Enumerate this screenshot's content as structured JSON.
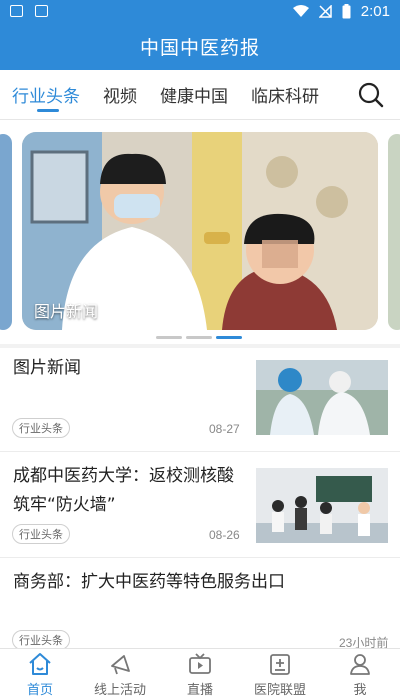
{
  "status_bar": {
    "time": "2:01"
  },
  "app": {
    "title": "中国中医药报"
  },
  "tabs": [
    {
      "label": "行业头条",
      "active": true
    },
    {
      "label": "视频",
      "active": false
    },
    {
      "label": "健康中国",
      "active": false
    },
    {
      "label": "临床科研",
      "active": false
    }
  ],
  "search": {
    "icon": "search-icon"
  },
  "banner": {
    "caption": "图片新闻",
    "pages": 3,
    "active_page": 3
  },
  "feed": [
    {
      "title_lines": [
        "图片新闻"
      ],
      "tag": "行业头条",
      "date": "08-27"
    },
    {
      "title_lines": [
        "成都中医药大学：返校测核酸",
        "筑牢“防火墙”"
      ],
      "tag": "行业头条",
      "date": "08-26"
    },
    {
      "title_lines": [
        "商务部：扩大中医药等特色服务出口"
      ],
      "tag": "行业头条",
      "date": "23小时前"
    }
  ],
  "bottom_nav": [
    {
      "label": "首页",
      "icon": "home-icon",
      "active": true
    },
    {
      "label": "线上活动",
      "icon": "megaphone-icon",
      "active": false
    },
    {
      "label": "直播",
      "icon": "tv-icon",
      "active": false
    },
    {
      "label": "医院联盟",
      "icon": "hospital-icon",
      "active": false
    },
    {
      "label": "我",
      "icon": "person-icon",
      "active": false
    }
  ],
  "colors": {
    "brand": "#2e8ad8",
    "text": "#222222",
    "muted": "#888888"
  }
}
